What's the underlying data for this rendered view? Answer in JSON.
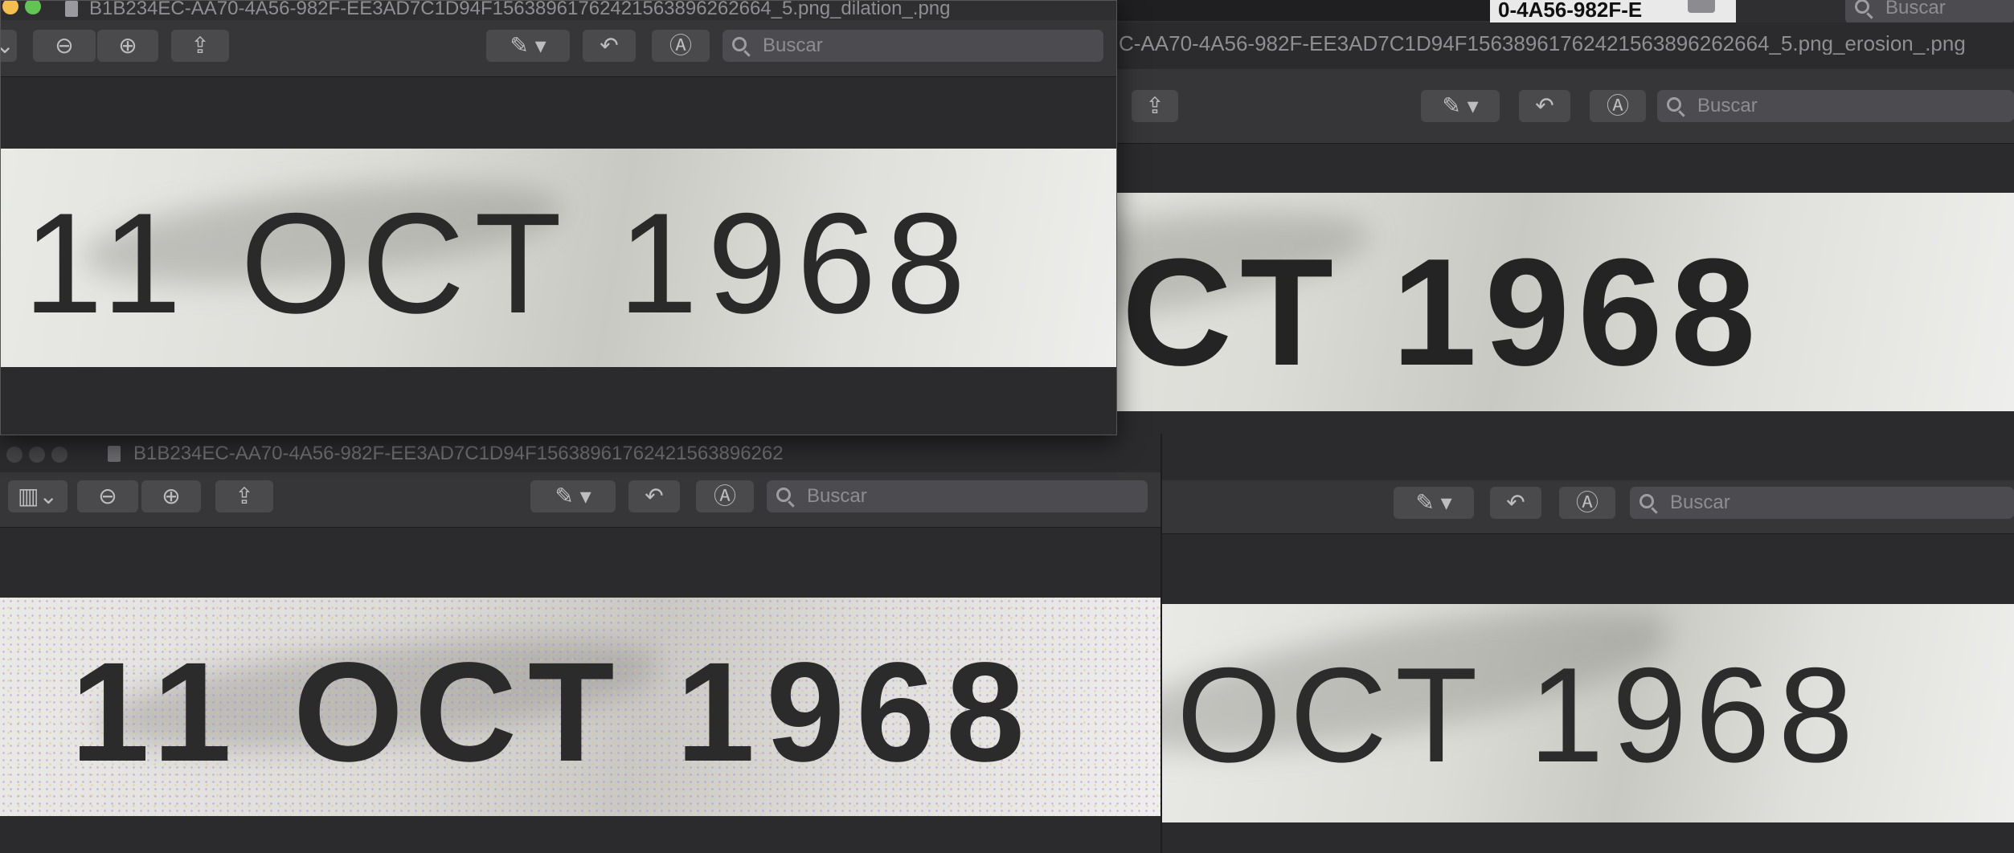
{
  "windows": {
    "dilation": {
      "title": "B1B234EC-AA70-4A56-982F-EE3AD7C1D94F1563896176242156389626​2664_5.png_dilation_.png",
      "image_text": "11 OCT 1968"
    },
    "erosion": {
      "title": "C-AA70-4A56-982F-EE3AD7C1D94F1563896176242156389626​2664_5.png_erosion_.png",
      "image_text": "OCT 1968"
    },
    "noise": {
      "title": "B1B234EC-AA70-4A56-982F-EE3AD7C1D94F15638961762421563896262",
      "image_text": "11 OCT 1968"
    },
    "original": {
      "image_text": "OCT 1968"
    }
  },
  "top_tab": {
    "label": "0-4A56-982F-E"
  },
  "search": {
    "placeholder": "Buscar"
  },
  "colors": {
    "window_bg": "#2b2b2d",
    "toolbar_bg": "#363538",
    "button_bg": "#4a494c",
    "text_dark": "#2a2a2a"
  },
  "icons": {
    "zoom_out": "zoom-out-icon",
    "zoom_in": "zoom-in-icon",
    "share": "share-icon",
    "markup": "markup-pen-icon",
    "rotate": "rotate-icon",
    "annotate": "annotate-icon",
    "search": "search-icon",
    "sidebar": "sidebar-icon"
  }
}
